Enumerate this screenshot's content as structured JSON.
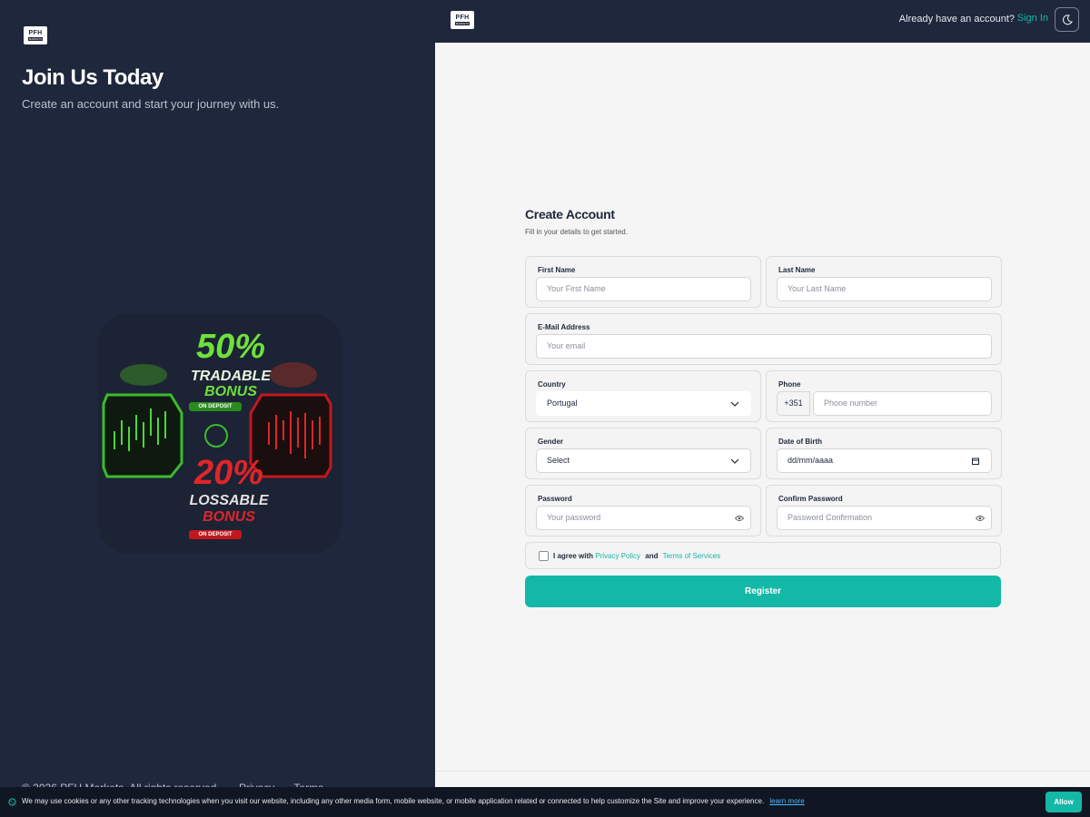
{
  "brand": {
    "logo_top": "PFH",
    "logo_bottom": "MARKETS"
  },
  "hero": {
    "title": "Join Us Today",
    "subtitle": "Create an account and start your journey with us."
  },
  "promo": {
    "pct1": "50%",
    "line1a": "TRADABLE",
    "line1b": "BONUS",
    "tag1": "ON DEPOSIT",
    "pct2": "20%",
    "line2a": "LOSSABLE",
    "line2b": "BONUS",
    "tag2": "ON DEPOSIT",
    "green": "#6fe03c",
    "red": "#e0252a"
  },
  "left_footer": {
    "copyright": "© 2026 PFH Markets. All rights reserved.",
    "privacy": "Privacy",
    "terms": "Terms"
  },
  "header": {
    "have_account": "Already have an account?",
    "sign_in": "Sign In",
    "theme_icon": "moon-icon"
  },
  "form": {
    "title": "Create Account",
    "subtitle": "Fill in your details to get started.",
    "first_name": {
      "label": "First Name",
      "placeholder": "Your First Name"
    },
    "last_name": {
      "label": "Last Name",
      "placeholder": "Your Last Name"
    },
    "email": {
      "label": "E-Mail Address",
      "placeholder": "Your email"
    },
    "country": {
      "label": "Country",
      "value": "Portugal"
    },
    "phone": {
      "label": "Phone",
      "prefix": "+351",
      "placeholder": "Phone number"
    },
    "gender": {
      "label": "Gender",
      "value": "Select"
    },
    "dob": {
      "label": "Date of Birth",
      "value": "dd/mm/aaaa"
    },
    "password": {
      "label": "Password",
      "placeholder": "Your password"
    },
    "confirm": {
      "label": "Confirm Password",
      "placeholder": "Password Confirmation"
    },
    "agree_prefix": "I agree with",
    "privacy": "Privacy Policy",
    "and": "and",
    "terms": "Terms of Services",
    "register": "Register"
  },
  "cookie": {
    "message": "We may use cookies or any other tracking technologies when you visit our website, including any other media form, mobile website, or mobile application related or connected to help customize the Site and improve your experience.",
    "learn_more": "learn more",
    "allow": "Allow"
  },
  "colors": {
    "accent": "#14b8a6",
    "panel": "#1e273b"
  }
}
